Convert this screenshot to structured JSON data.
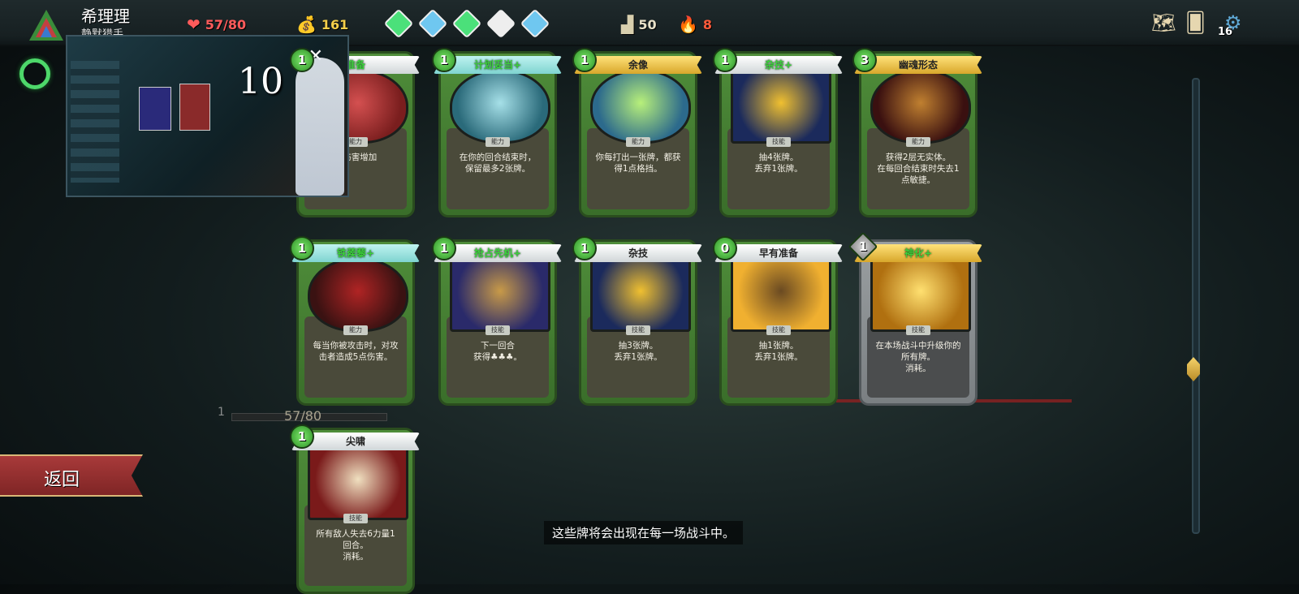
{
  "topbar": {
    "character_name": "希理理",
    "character_class": "静默猎手",
    "hp": "57/80",
    "gold": "161",
    "floor": "50",
    "ascension": "8",
    "deck_count": "16",
    "potions": [
      {
        "color": "#4be07a"
      },
      {
        "color": "#6fc7f0"
      },
      {
        "color": "#4be07a"
      },
      {
        "color": "#eeeeee"
      },
      {
        "color": "#6fc7f0"
      }
    ]
  },
  "stream_overlay": {
    "counter": "10",
    "close": "✕"
  },
  "cards": [
    {
      "name": "准备",
      "cost": "1",
      "type": "能力",
      "desc": "的伤害增加",
      "color": "green",
      "upgraded": true
    },
    {
      "name": "计划妥当+",
      "cost": "1",
      "type": "能力",
      "desc": "在你的回合结束时，\n保留最多2张牌。",
      "color": "green",
      "upgraded": true
    },
    {
      "name": "余像",
      "cost": "1",
      "type": "能力",
      "desc": "你每打出一张牌，都获\n得1点格挡。",
      "color": "green",
      "upgraded": false
    },
    {
      "name": "杂技+",
      "cost": "1",
      "type": "技能",
      "desc": "抽4张牌。\n丢弃1张牌。",
      "color": "green",
      "upgraded": true
    },
    {
      "name": "幽魂形态",
      "cost": "3",
      "type": "能力",
      "desc": "获得2层无实体。\n在每回合结束时失去1\n点敏捷。",
      "color": "green",
      "upgraded": false
    },
    {
      "name": "铁蒺藜+",
      "cost": "1",
      "type": "能力",
      "desc": "每当你被攻击时，对攻\n击者造成5点伤害。",
      "color": "green",
      "upgraded": true
    },
    {
      "name": "抢占先机+",
      "cost": "1",
      "type": "技能",
      "desc": "下一回合\n获得♣♣♣。",
      "color": "green",
      "upgraded": true
    },
    {
      "name": "杂技",
      "cost": "1",
      "type": "技能",
      "desc": "抽3张牌。\n丢弃1张牌。",
      "color": "green",
      "upgraded": false
    },
    {
      "name": "早有准备",
      "cost": "0",
      "type": "技能",
      "desc": "抽1张牌。\n丢弃1张牌。",
      "color": "green",
      "upgraded": false
    },
    {
      "name": "神化+",
      "cost": "1",
      "type": "技能",
      "desc": "在本场战斗中升级你的\n所有牌。\n消耗。",
      "color": "colorless",
      "upgraded": true
    },
    {
      "name": "尖啸",
      "cost": "1",
      "type": "技能",
      "desc": "所有敌人失去6力量1\n回合。\n消耗。",
      "color": "green",
      "upgraded": false
    }
  ],
  "background": {
    "ghost_hp": "57/80",
    "ghost_block": "1"
  },
  "back_button": "返回",
  "info_text": "这些牌将会出现在每一场战斗中。"
}
